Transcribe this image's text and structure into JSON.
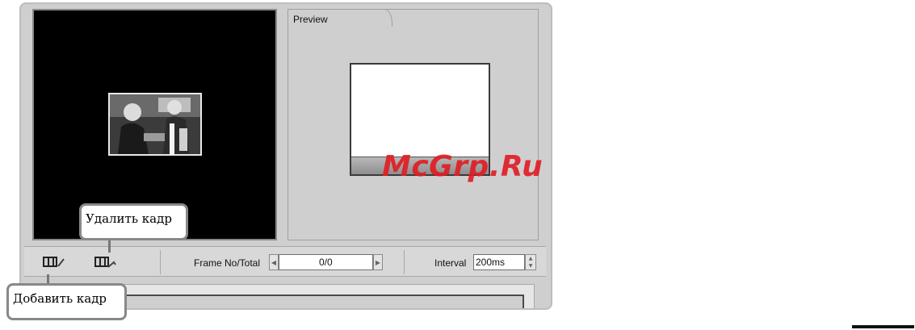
{
  "preview": {
    "tab_label": "Preview"
  },
  "toolbar": {
    "frame_label": "Frame No/Total",
    "frame_value": "0/0",
    "interval_label": "Interval",
    "interval_value": "200ms",
    "icons": [
      "add-frame-icon",
      "delete-frame-icon"
    ]
  },
  "callouts": {
    "delete_frame": "Удалить кадр",
    "add_frame": "Добавить кадр"
  },
  "watermark": "McGrp.Ru",
  "colors": {
    "accent": "#e11b22",
    "panel": "#cfcfcf",
    "frames_bg": "#000000"
  }
}
